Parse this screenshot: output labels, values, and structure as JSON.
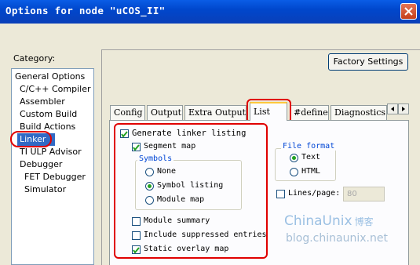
{
  "window": {
    "title": "Options for node \"uCOS_II\""
  },
  "category": {
    "label": "Category:",
    "items": [
      "General Options",
      "C/C++ Compiler",
      "Assembler",
      "Custom Build",
      "Build Actions",
      "Linker",
      "TI ULP Advisor",
      "Debugger",
      "FET Debugger",
      "Simulator"
    ],
    "selected": "Linker"
  },
  "factory_settings_label": "Factory Settings",
  "tabs": [
    "Config",
    "Output",
    "Extra Output",
    "List",
    "#define",
    "Diagnostics"
  ],
  "active_tab": "List",
  "list_page": {
    "generate_listing": {
      "label": "Generate linker listing",
      "checked": true
    },
    "segment_map": {
      "label": "Segment map",
      "checked": true
    },
    "symbols": {
      "title": "Symbols",
      "options": [
        "None",
        "Symbol listing",
        "Module map"
      ],
      "selected": "Symbol listing"
    },
    "module_summary": {
      "label": "Module summary",
      "checked": false
    },
    "include_suppressed": {
      "label": "Include suppressed entries",
      "checked": false
    },
    "static_overlay": {
      "label": "Static overlay map",
      "checked": true
    },
    "file_format": {
      "title": "File format",
      "options": [
        "Text",
        "HTML"
      ],
      "selected": "Text"
    },
    "lines_per_page": {
      "label": "Lines/page:",
      "checked": false,
      "value": "80"
    }
  },
  "watermark": {
    "brand": "ChinaUnix",
    "brand_cn": "博客",
    "url": "blog.chinaunix.net"
  }
}
